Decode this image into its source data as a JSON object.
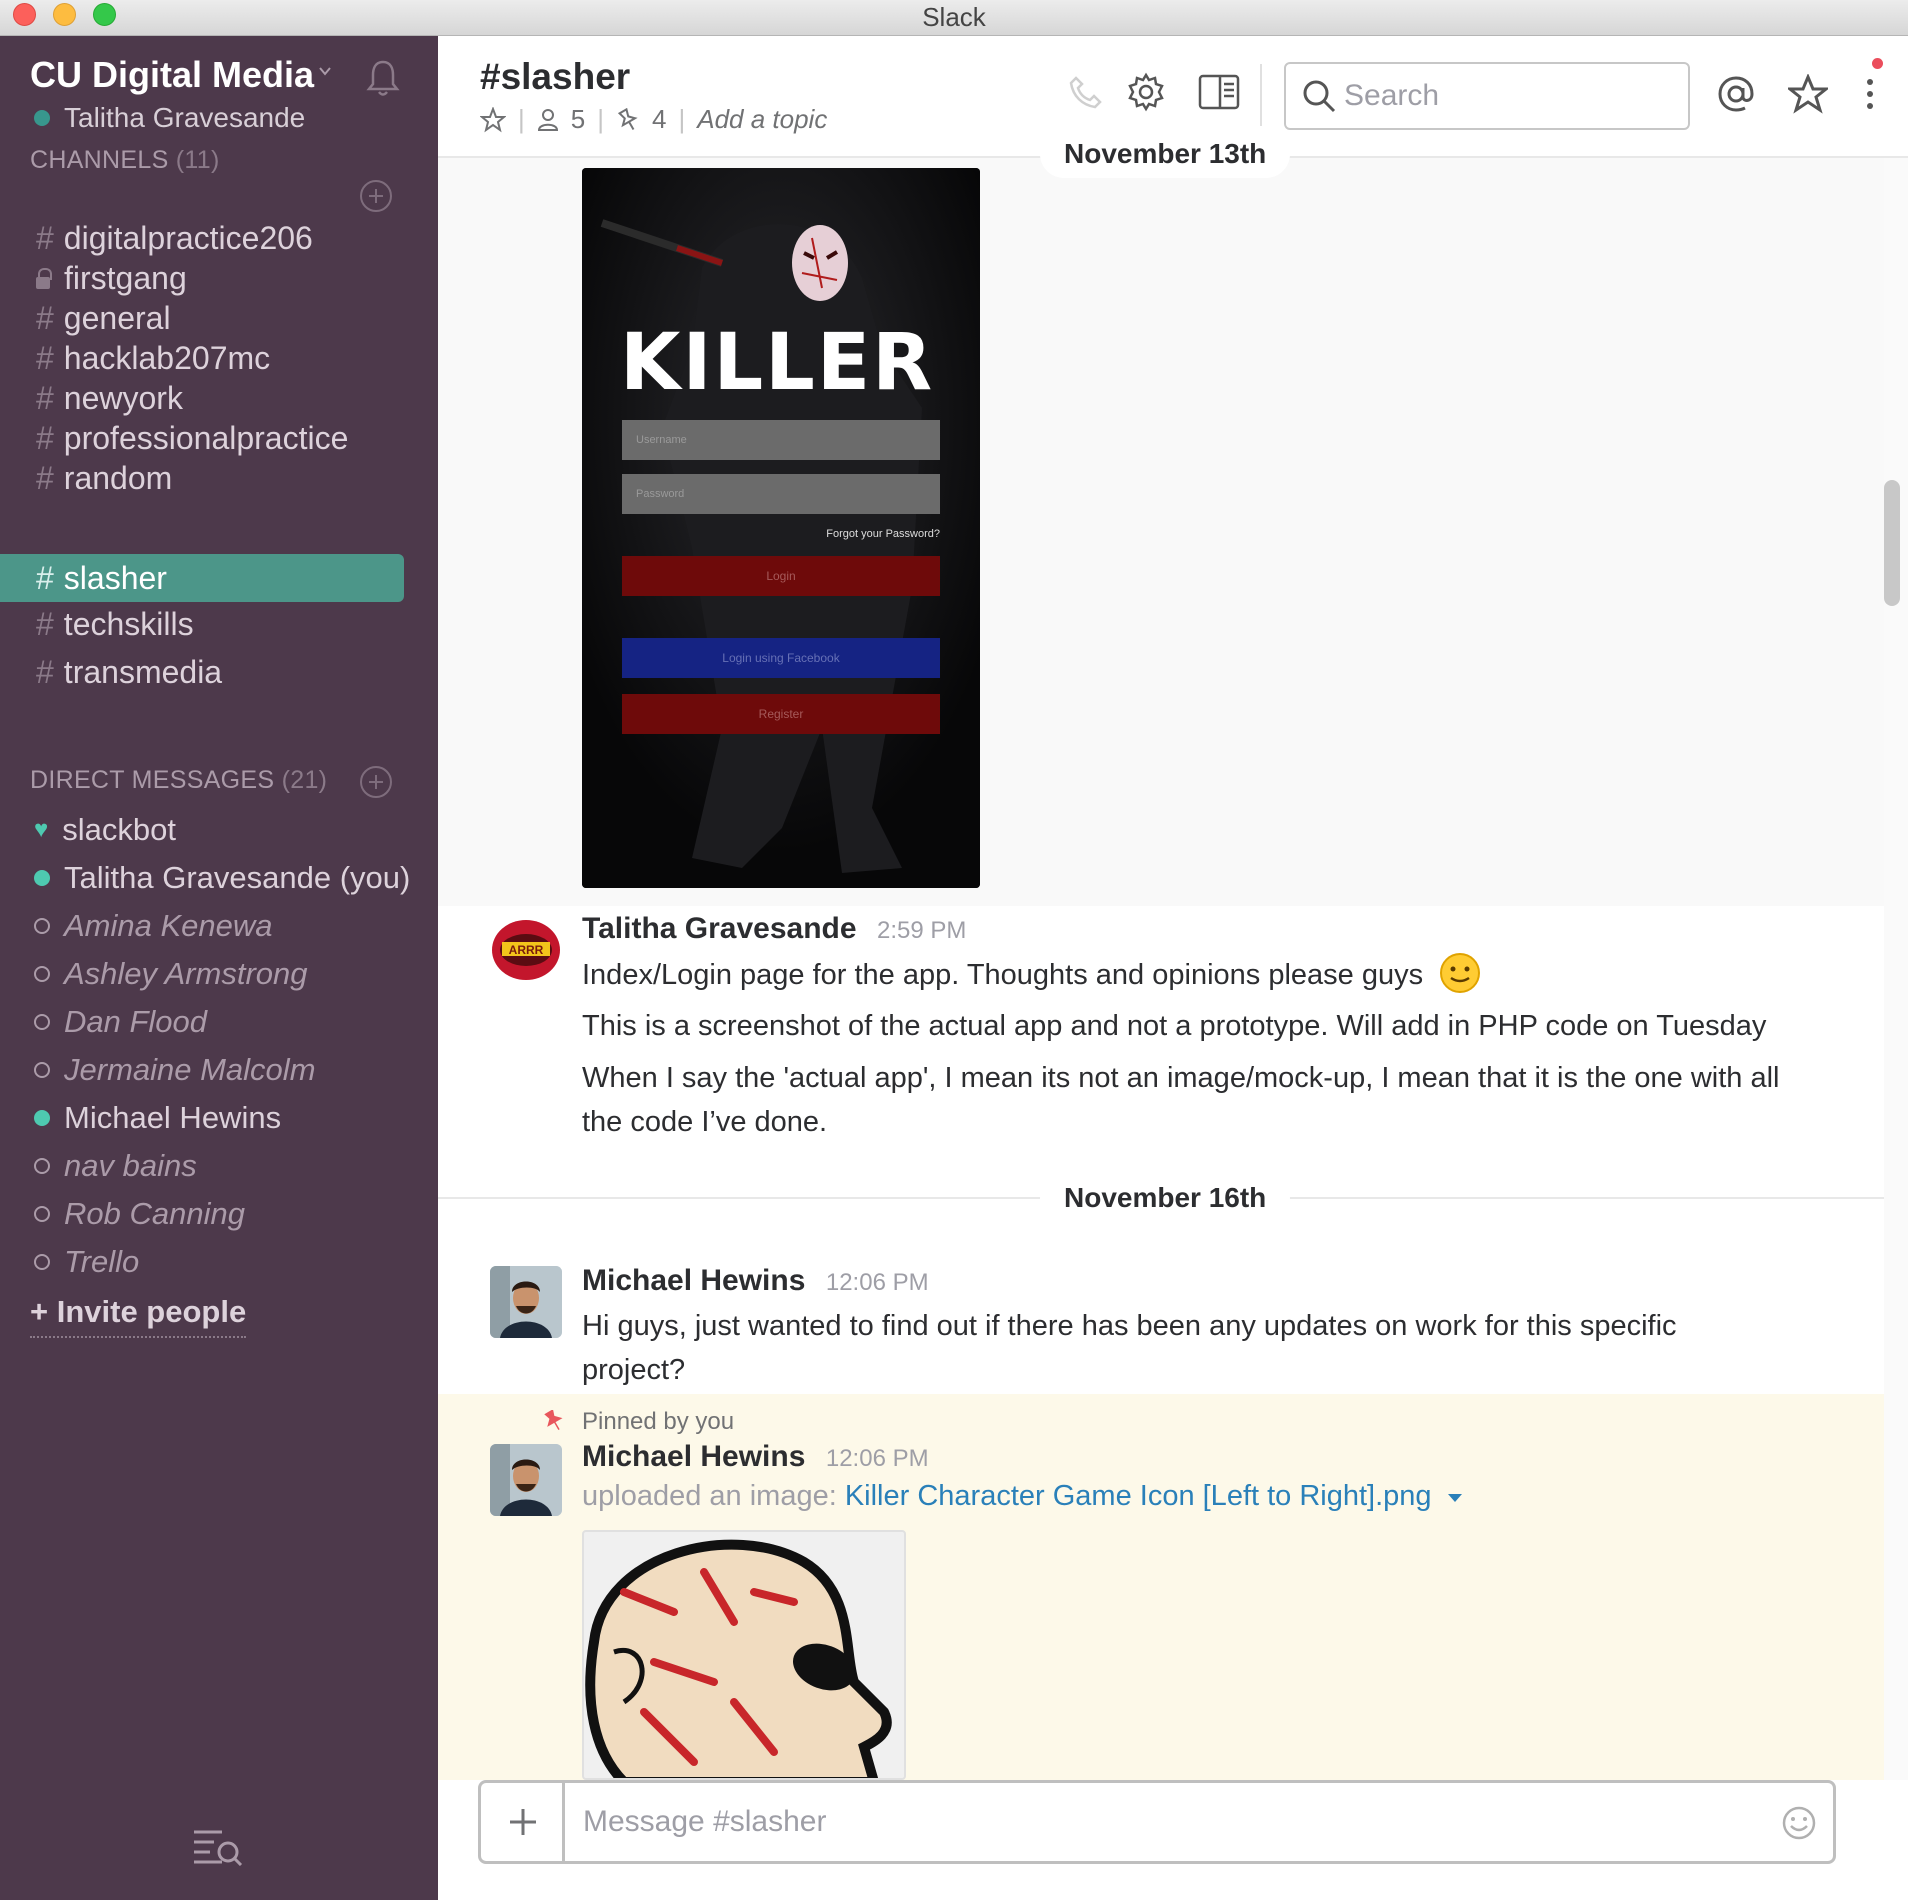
{
  "window": {
    "title": "Slack"
  },
  "sidebar": {
    "team_name": "CU Digital Media",
    "user_name": "Talitha Gravesande",
    "channels_header": "CHANNELS",
    "channels_count": "(11)",
    "channels": [
      {
        "name": "digitalpractice206",
        "private": false,
        "active": false
      },
      {
        "name": "firstgang",
        "private": true,
        "active": false
      },
      {
        "name": "general",
        "private": false,
        "active": false
      },
      {
        "name": "hacklab207mc",
        "private": false,
        "active": false
      },
      {
        "name": "newyork",
        "private": false,
        "active": false
      },
      {
        "name": "professionalpractice",
        "private": false,
        "active": false
      },
      {
        "name": "random",
        "private": false,
        "active": false
      },
      {
        "name": "slasher",
        "private": false,
        "active": true
      },
      {
        "name": "techskills",
        "private": false,
        "active": false
      },
      {
        "name": "transmedia",
        "private": false,
        "active": false
      }
    ],
    "dm_header": "DIRECT MESSAGES",
    "dm_count": "(21)",
    "dms": [
      {
        "name": "slackbot",
        "status": "bot"
      },
      {
        "name": "Talitha Gravesande (you)",
        "status": "online"
      },
      {
        "name": "Amina Kenewa",
        "status": "away"
      },
      {
        "name": "Ashley Armstrong",
        "status": "away"
      },
      {
        "name": "Dan Flood",
        "status": "away"
      },
      {
        "name": "Jermaine Malcolm",
        "status": "away"
      },
      {
        "name": "Michael Hewins",
        "status": "online"
      },
      {
        "name": "nav bains",
        "status": "away"
      },
      {
        "name": "Rob Canning",
        "status": "away"
      },
      {
        "name": "Trello",
        "status": "away"
      }
    ],
    "invite_label": "+ Invite people"
  },
  "header": {
    "channel_title": "#slasher",
    "members_count": "5",
    "pins_count": "4",
    "topic_placeholder": "Add a topic",
    "search_placeholder": "Search"
  },
  "messages": {
    "date1": "November 13th",
    "mockup": {
      "title": "KILLER",
      "username_placeholder": "Username",
      "password_placeholder": "Password",
      "forgot": "Forgot your Password?",
      "login": "Login",
      "facebook": "Login using Facebook",
      "register": "Register"
    },
    "msg1": {
      "author": "Talitha Gravesande",
      "time": "2:59 PM",
      "line1": "Index/Login page for the app. Thoughts and opinions please guys",
      "line2": "This is a screenshot of the actual app and not a prototype. Will add in PHP code on Tuesday",
      "line3": "When I say the 'actual app', I mean its not an image/mock-up, I mean that it is the one with all the code I’ve done."
    },
    "date2": "November 16th",
    "msg2": {
      "author": "Michael Hewins",
      "time": "12:06 PM",
      "text": "Hi guys, just wanted to find out if there has been any updates on work for this specific project?"
    },
    "msg3": {
      "pinned_label": "Pinned by you",
      "author": "Michael Hewins",
      "time": "12:06 PM",
      "prefix": "uploaded an image:",
      "file_name": "Killer Character Game Icon [Left to Right].png"
    }
  },
  "composer": {
    "placeholder": "Message #slasher"
  },
  "colors": {
    "sidebar_bg": "#4d394b",
    "active_channel": "#4c9689",
    "online": "#38978d",
    "link": "#2a80b9",
    "pinned_bg": "#fdf9e9"
  }
}
